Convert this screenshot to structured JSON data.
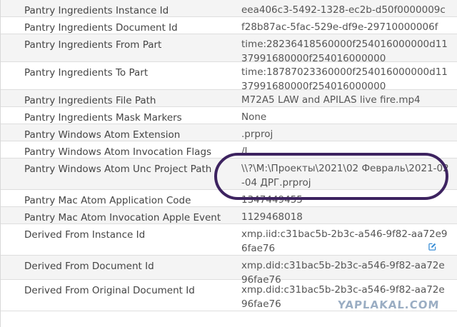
{
  "rows": [
    {
      "label": "Pantry Ingredients Instance Id",
      "value": "eea406c3-5492-1328-ec2b-d50f0000009c",
      "alt": true
    },
    {
      "label": "Pantry Ingredients Document Id",
      "value": "f28b87ac-5fac-529e-df9e-29710000006f",
      "alt": false
    },
    {
      "label": "Pantry Ingredients From Part",
      "value": "time:28236418560000f254016000000d1137991680000f254016000000",
      "alt": true
    },
    {
      "label": "Pantry Ingredients To Part",
      "value": "time:18787023360000f254016000000d1137991680000f254016000000",
      "alt": false
    },
    {
      "label": "Pantry Ingredients File Path",
      "value": "M72A5 LAW and APILAS live fire.mp4",
      "alt": true
    },
    {
      "label": "Pantry Ingredients Mask Markers",
      "value": "None",
      "alt": false
    },
    {
      "label": "Pantry Windows Atom Extension",
      "value": ".prproj",
      "alt": true
    },
    {
      "label": "Pantry Windows Atom Invocation Flags",
      "value": "/L",
      "alt": false
    },
    {
      "label": "Pantry Windows Atom Unc Project Path",
      "value": "\\\\?\\M:\\Проекты\\2021\\02 Февраль\\2021-02-04 ДРГ.prproj",
      "alt": true
    },
    {
      "label": "Pantry Mac Atom Application Code",
      "value": "1347449455",
      "alt": false
    },
    {
      "label": "Pantry Mac Atom Invocation Apple Event",
      "value": "1129468018",
      "alt": true
    },
    {
      "label": "Derived From Instance Id",
      "value": "xmp.iid:c31bac5b-2b3c-a546-9f82-aa72e96fae76",
      "alt": false,
      "edit_icon": "edit-square-icon"
    },
    {
      "label": "Derived From Document Id",
      "value": "xmp.did:c31bac5b-2b3c-a546-9f82-aa72e96fae76",
      "alt": true
    },
    {
      "label": "Derived From Original Document Id",
      "value": "xmp.did:c31bac5b-2b3c-a546-9f82-aa72e96fae76",
      "alt": false
    }
  ],
  "watermark": "YAPLAKAL.COM",
  "colors": {
    "highlight_oval": "#3d2360",
    "edit_icon": "#3b8fd6",
    "row_alt": "#f4f4f4"
  }
}
